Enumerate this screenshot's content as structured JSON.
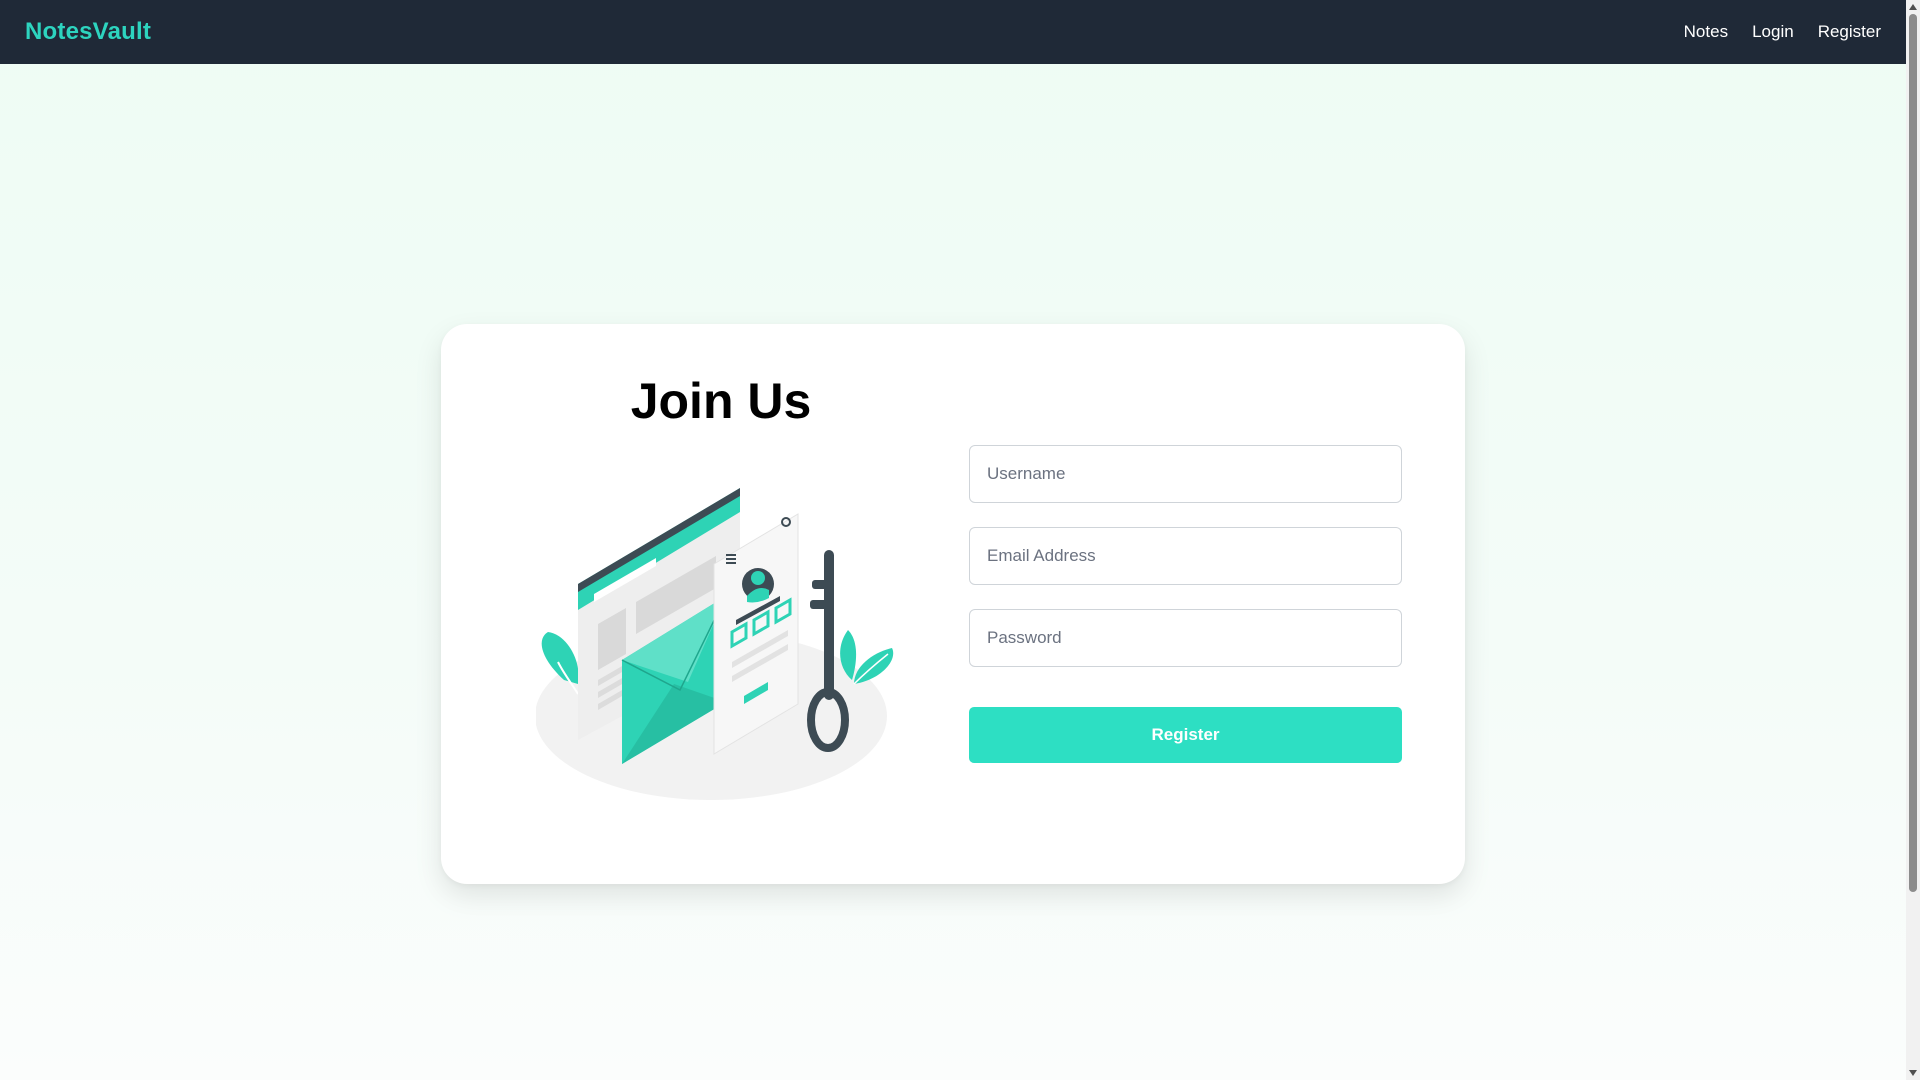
{
  "navbar": {
    "brand": "NotesVault",
    "links": [
      "Notes",
      "Login",
      "Register"
    ]
  },
  "form": {
    "title": "Join Us",
    "username_placeholder": "Username",
    "email_placeholder": "Email Address",
    "password_placeholder": "Password",
    "submit_label": "Register"
  },
  "colors": {
    "navbar_bg": "#1f2937",
    "brand": "#2dd4bf",
    "accent": "#2ddfc3",
    "illustration_teal": "#2ed3b5",
    "illustration_dark": "#3d4b54"
  }
}
